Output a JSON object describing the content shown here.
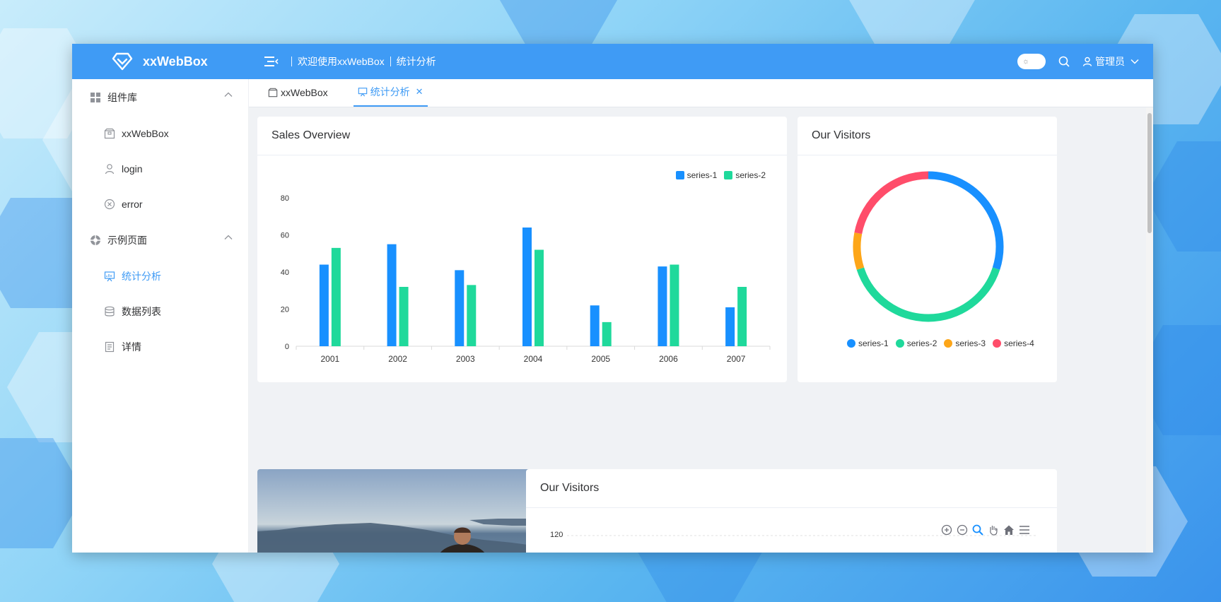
{
  "app": {
    "title": "xxWebBox"
  },
  "header": {
    "breadcrumb": [
      "欢迎使用xxWebBox",
      "统计分析"
    ],
    "user_label": "管理员"
  },
  "sidebar": {
    "groups": [
      {
        "label": "组件库",
        "items": [
          {
            "label": "xxWebBox",
            "icon": "box-icon"
          },
          {
            "label": "login",
            "icon": "user-icon"
          },
          {
            "label": "error",
            "icon": "circle-x-icon"
          }
        ]
      },
      {
        "label": "示例页面",
        "items": [
          {
            "label": "统计分析",
            "icon": "presentation-chart-icon",
            "active": true
          },
          {
            "label": "数据列表",
            "icon": "database-icon"
          },
          {
            "label": "详情",
            "icon": "document-icon"
          }
        ]
      }
    ]
  },
  "tabs": [
    {
      "label": "xxWebBox",
      "active": false
    },
    {
      "label": "统计分析",
      "active": true
    }
  ],
  "colors": {
    "primary": "#3f9bf5",
    "series1": "#1890ff",
    "series2": "#1fd99b",
    "series3": "#fda619",
    "series4": "#ff4d6a"
  },
  "cards": {
    "sales": {
      "title": "Sales Overview"
    },
    "visitors_pie": {
      "title": "Our Visitors"
    },
    "visitors_area": {
      "title": "Our Visitors"
    }
  },
  "chart_data": [
    {
      "type": "bar",
      "title": "Sales Overview",
      "categories": [
        "2001",
        "2002",
        "2003",
        "2004",
        "2005",
        "2006",
        "2007"
      ],
      "series": [
        {
          "name": "series-1",
          "values": [
            44,
            55,
            41,
            64,
            22,
            43,
            21
          ]
        },
        {
          "name": "series-2",
          "values": [
            53,
            32,
            33,
            52,
            13,
            44,
            32
          ]
        }
      ],
      "yticks": [
        "0",
        "20",
        "40",
        "60",
        "80"
      ],
      "ylim": [
        0,
        80
      ],
      "legend": "top-right",
      "grid": false
    },
    {
      "type": "pie",
      "title": "Our Visitors",
      "donut": true,
      "series": [
        {
          "name": "series-1",
          "value": 30
        },
        {
          "name": "series-2",
          "value": 40
        },
        {
          "name": "series-3",
          "value": 8
        },
        {
          "name": "series-4",
          "value": 22
        }
      ],
      "legend": "bottom"
    },
    {
      "type": "area",
      "title": "Our Visitors",
      "yticks": [
        "120"
      ],
      "toolbar": [
        "zoom-in-icon",
        "zoom-out-icon",
        "magnify-icon",
        "pan-hand-icon",
        "home-icon",
        "menu-icon"
      ]
    }
  ]
}
